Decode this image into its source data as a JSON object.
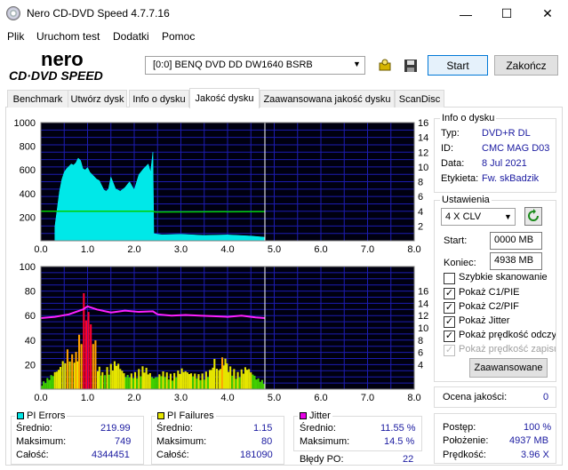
{
  "window": {
    "title": "Nero CD-DVD Speed 4.7.7.16",
    "minimize_glyph": "—",
    "maximize_glyph": "☐",
    "close_glyph": "✕"
  },
  "menu": [
    "Plik",
    "Uruchom test",
    "Dodatki",
    "Pomoc"
  ],
  "logo": {
    "top": "nero",
    "bottom": "CD·DVD SPEED"
  },
  "toolbar": {
    "drive": "[0:0]   BENQ DVD DD DW1640 BSRB",
    "start_label": "Start",
    "end_label": "Zakończ"
  },
  "tabs": [
    "Benchmark",
    "Utwórz dysk",
    "Info o dysku",
    "Jakość dysku",
    "Zaawansowana jakość dysku",
    "ScanDisc"
  ],
  "active_tab": 3,
  "disc_info": {
    "title": "Info o dysku",
    "type_label": "Typ:",
    "type_value": "DVD+R DL",
    "id_label": "ID:",
    "id_value": "CMC MAG D03",
    "date_label": "Data:",
    "date_value": "8 Jul 2021",
    "label_label": "Etykieta:",
    "label_value": "Fw. skBadzik"
  },
  "settings": {
    "title": "Ustawienia",
    "speed": "4 X CLV",
    "start_label": "Start:",
    "start_value": "0000 MB",
    "end_label": "Koniec:",
    "end_value": "4938 MB",
    "checkboxes": [
      {
        "label": "Szybkie skanowanie",
        "checked": false,
        "enabled": true
      },
      {
        "label": "Pokaż C1/PIE",
        "checked": true,
        "enabled": true
      },
      {
        "label": "Pokaż C2/PIF",
        "checked": true,
        "enabled": true
      },
      {
        "label": "Pokaż Jitter",
        "checked": true,
        "enabled": true
      },
      {
        "label": "Pokaż prędkość odczytu",
        "checked": true,
        "enabled": true
      },
      {
        "label": "Pokaż prędkość zapisu",
        "checked": true,
        "enabled": false
      }
    ],
    "advanced_label": "Zaawansowane"
  },
  "quality": {
    "label": "Ocena jakości:",
    "value": "0"
  },
  "progress": {
    "progress_label": "Postęp:",
    "progress_value": "100 %",
    "position_label": "Położenie:",
    "position_value": "4937 MB",
    "speed_label": "Prędkość:",
    "speed_value": "3.96 X"
  },
  "pi_errors": {
    "title": "PI Errors",
    "color": "#00e5e5",
    "avg_label": "Średnio:",
    "avg": "219.99",
    "max_label": "Maksimum:",
    "max": "749",
    "total_label": "Całość:",
    "total": "4344451"
  },
  "pi_failures": {
    "title": "PI Failures",
    "color": "#e5e500",
    "avg_label": "Średnio:",
    "avg": "1.15",
    "max_label": "Maksimum:",
    "max": "80",
    "total_label": "Całość:",
    "total": "181090"
  },
  "jitter": {
    "title": "Jitter",
    "color": "#e500e5",
    "avg_label": "Średnio:",
    "avg": "11.55 %",
    "max_label": "Maksimum:",
    "max": "14.5 %",
    "po_label": "Błędy PO:",
    "po": "22"
  },
  "chart_data": [
    {
      "type": "area",
      "name": "pi-errors-chart",
      "x_ticks": [
        "0.0",
        "1.0",
        "2.0",
        "3.0",
        "4.0",
        "5.0",
        "6.0",
        "7.0",
        "8.0"
      ],
      "y_left_ticks": [
        "200",
        "400",
        "600",
        "800",
        "1000"
      ],
      "y_right_ticks": [
        "2",
        "4",
        "6",
        "8",
        "10",
        "12",
        "14",
        "16"
      ],
      "xlim": [
        0,
        8
      ],
      "ylim_left": [
        0,
        1000
      ],
      "ylim_right": [
        0,
        16
      ],
      "pi_errors": {
        "x": [
          0.3,
          0.4,
          0.45,
          0.5,
          0.55,
          0.6,
          0.65,
          0.7,
          0.75,
          0.8,
          0.85,
          0.9,
          0.95,
          1.0,
          1.05,
          1.1,
          1.15,
          1.2,
          1.25,
          1.3,
          1.35,
          1.4,
          1.45,
          1.5,
          1.6,
          1.7,
          1.8,
          1.9,
          2.0,
          2.1,
          2.2,
          2.3,
          2.35,
          2.4,
          2.42,
          2.6,
          3.0,
          3.5,
          4.0,
          4.5,
          4.8
        ],
        "y": [
          120,
          420,
          520,
          580,
          610,
          630,
          650,
          640,
          660,
          700,
          680,
          610,
          600,
          620,
          580,
          560,
          540,
          520,
          510,
          470,
          430,
          420,
          440,
          540,
          440,
          420,
          450,
          500,
          430,
          560,
          610,
          650,
          580,
          750,
          60,
          50,
          55,
          45,
          50,
          40,
          30
        ]
      },
      "read_speed": {
        "x": [
          0.0,
          0.3,
          2.4,
          2.45,
          4.8
        ],
        "y": [
          4.0,
          4.0,
          4.0,
          3.9,
          3.95
        ]
      }
    },
    {
      "type": "area",
      "name": "pi-failures-chart",
      "x_ticks": [
        "0.0",
        "1.0",
        "2.0",
        "3.0",
        "4.0",
        "5.0",
        "6.0",
        "7.0",
        "8.0"
      ],
      "y_left_ticks": [
        "20",
        "40",
        "60",
        "80",
        "100"
      ],
      "y_right_ticks": [
        "4",
        "6",
        "8",
        "10",
        "12",
        "14",
        "16"
      ],
      "xlim": [
        0,
        8
      ],
      "ylim_left": [
        0,
        100
      ],
      "ylim_right": [
        0,
        20
      ],
      "pi_failures": {
        "x": [
          0.0,
          0.2,
          0.4,
          0.5,
          0.6,
          0.7,
          0.8,
          0.85,
          0.9,
          0.95,
          1.0,
          1.05,
          1.1,
          1.15,
          1.2,
          1.3,
          1.4,
          1.6,
          1.8,
          2.0,
          2.2,
          2.4,
          2.6,
          2.8,
          3.0,
          3.2,
          3.4,
          3.6,
          3.7,
          3.8,
          3.9,
          4.0,
          4.2,
          4.4,
          4.6,
          4.8
        ],
        "y": [
          5,
          12,
          20,
          30,
          35,
          25,
          45,
          65,
          80,
          70,
          75,
          55,
          60,
          40,
          20,
          15,
          18,
          25,
          12,
          14,
          20,
          10,
          15,
          12,
          18,
          14,
          12,
          16,
          25,
          18,
          30,
          20,
          14,
          20,
          10,
          6
        ]
      },
      "jitter": {
        "x": [
          0.0,
          0.3,
          0.6,
          0.9,
          1.0,
          1.2,
          1.5,
          1.8,
          2.1,
          2.4,
          2.5,
          2.8,
          3.1,
          3.4,
          3.7,
          4.0,
          4.3,
          4.6,
          4.8
        ],
        "y": [
          11.6,
          11.8,
          12.2,
          13.0,
          13.5,
          13.0,
          12.5,
          12.8,
          12.6,
          12.7,
          12.2,
          12.0,
          12.1,
          12.0,
          11.9,
          11.8,
          12.0,
          11.7,
          11.6
        ]
      }
    }
  ]
}
